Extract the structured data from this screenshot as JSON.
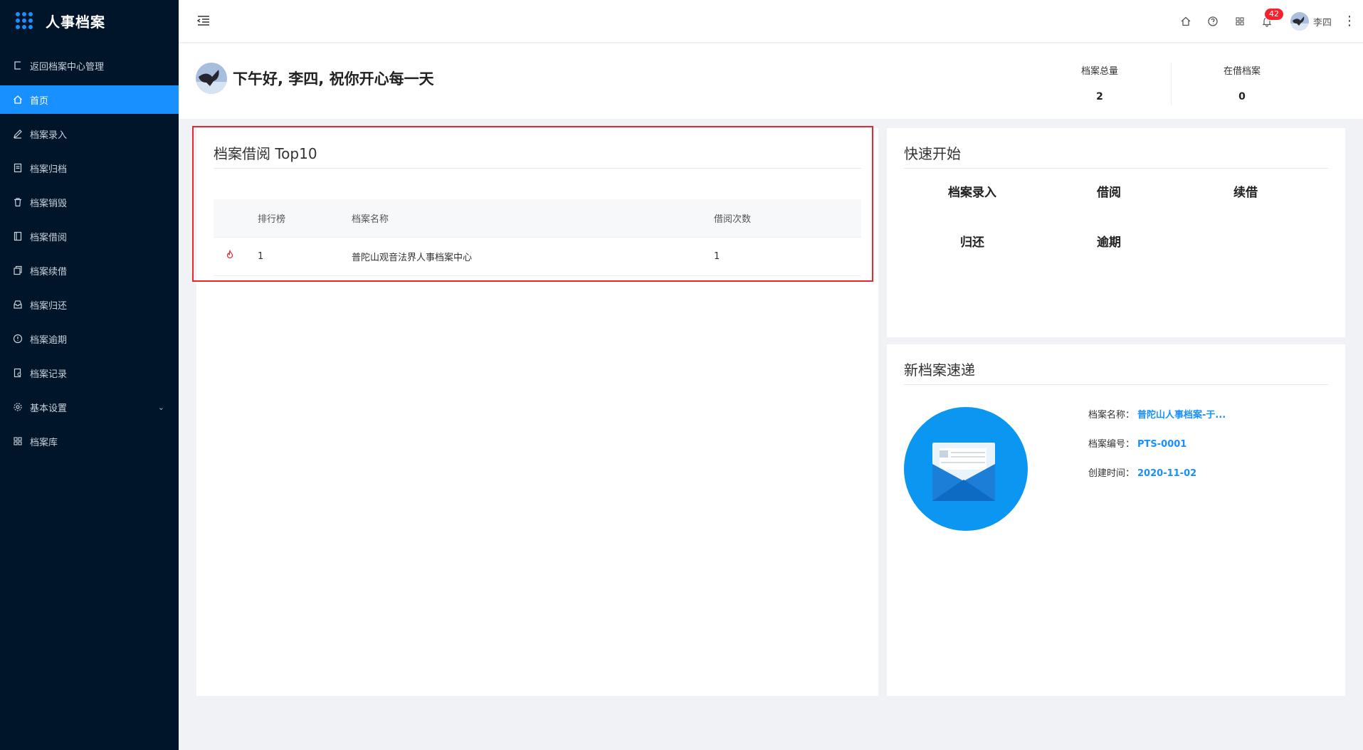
{
  "app": {
    "title": "人事档案"
  },
  "sidebar": {
    "items": [
      {
        "label": "返回档案中心管理",
        "icon": "return-icon"
      },
      {
        "label": "首页",
        "icon": "home-icon"
      },
      {
        "label": "档案录入",
        "icon": "edit-icon"
      },
      {
        "label": "档案归档",
        "icon": "archive-icon"
      },
      {
        "label": "档案销毁",
        "icon": "trash-icon"
      },
      {
        "label": "档案借阅",
        "icon": "book-icon"
      },
      {
        "label": "档案续借",
        "icon": "copy-icon"
      },
      {
        "label": "档案归还",
        "icon": "inbox-icon"
      },
      {
        "label": "档案逾期",
        "icon": "alert-circle-icon"
      },
      {
        "label": "档案记录",
        "icon": "record-icon"
      },
      {
        "label": "基本设置",
        "icon": "gear-icon"
      },
      {
        "label": "档案库",
        "icon": "grid-icon"
      }
    ]
  },
  "header": {
    "notification_count": "42",
    "user_name": "李四",
    "more": "⋮"
  },
  "greeting": {
    "text": "下午好, 李四, 祝你开心每一天",
    "stats": [
      {
        "label": "档案总量",
        "value": "2"
      },
      {
        "label": "在借档案",
        "value": "0"
      }
    ]
  },
  "top10": {
    "title": "档案借阅 Top10",
    "columns": [
      "排行榜",
      "档案名称",
      "借阅次数"
    ],
    "rows": [
      {
        "rank": "1",
        "name": "普陀山观音法界人事档案中心",
        "count": "1"
      }
    ]
  },
  "quick_start": {
    "title": "快速开始",
    "items": [
      "档案录入",
      "借阅",
      "续借",
      "归还",
      "逾期"
    ]
  },
  "new_archive": {
    "title": "新档案速递",
    "fields": [
      {
        "key": "档案名称：",
        "value": "普陀山人事档案-于..."
      },
      {
        "key": "档案编号：",
        "value": "PTS-0001"
      },
      {
        "key": "创建时间：",
        "value": "2020-11-02"
      }
    ]
  },
  "colors": {
    "sidebar_bg": "#001529",
    "accent": "#1890ff",
    "highlight_border": "#e8262d",
    "badge": "#f5222d"
  }
}
